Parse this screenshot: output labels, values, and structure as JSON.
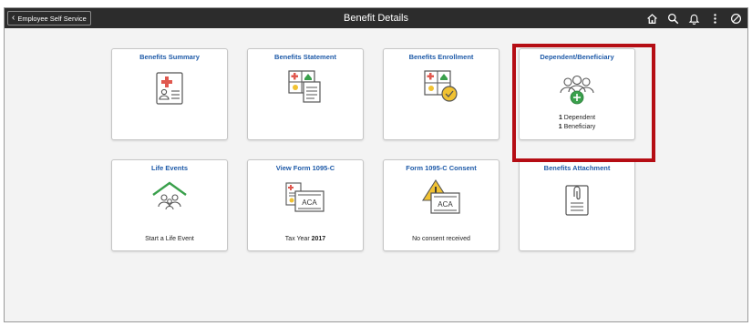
{
  "header": {
    "back_label": "Employee Self Service",
    "title": "Benefit Details",
    "icons": [
      "home-icon",
      "search-icon",
      "notification-bell-icon",
      "actions-menu-icon",
      "navbar-icon"
    ]
  },
  "tiles": [
    {
      "title": "Benefits Summary",
      "icon": "benefits-summary-icon"
    },
    {
      "title": "Benefits Statement",
      "icon": "benefits-statement-icon"
    },
    {
      "title": "Benefits Enrollment",
      "icon": "benefits-enrollment-icon"
    },
    {
      "title": "Dependent/Beneficiary",
      "icon": "add-dependents-icon",
      "dependent_count": "1",
      "dependent_label": "Dependent",
      "beneficiary_count": "1",
      "beneficiary_label": "Beneficiary"
    },
    {
      "title": "Life Events",
      "icon": "life-events-house-icon",
      "footer": "Start a Life Event"
    },
    {
      "title": "View Form 1095-C",
      "icon": "form-1095c-icon",
      "footer_label": "Tax Year",
      "footer_value": "2017",
      "aca_label": "ACA"
    },
    {
      "title": "Form 1095-C Consent",
      "icon": "consent-warning-icon",
      "footer": "No consent received",
      "aca_label": "ACA"
    },
    {
      "title": "Benefits Attachment",
      "icon": "attachment-icon"
    }
  ],
  "colors": {
    "header_bg": "#2c2c2c",
    "tile_title": "#1e5aa8",
    "highlight_border": "#b50d14",
    "icon_red": "#e0584f",
    "icon_green": "#3aa04c",
    "icon_yellow": "#f1c232"
  }
}
